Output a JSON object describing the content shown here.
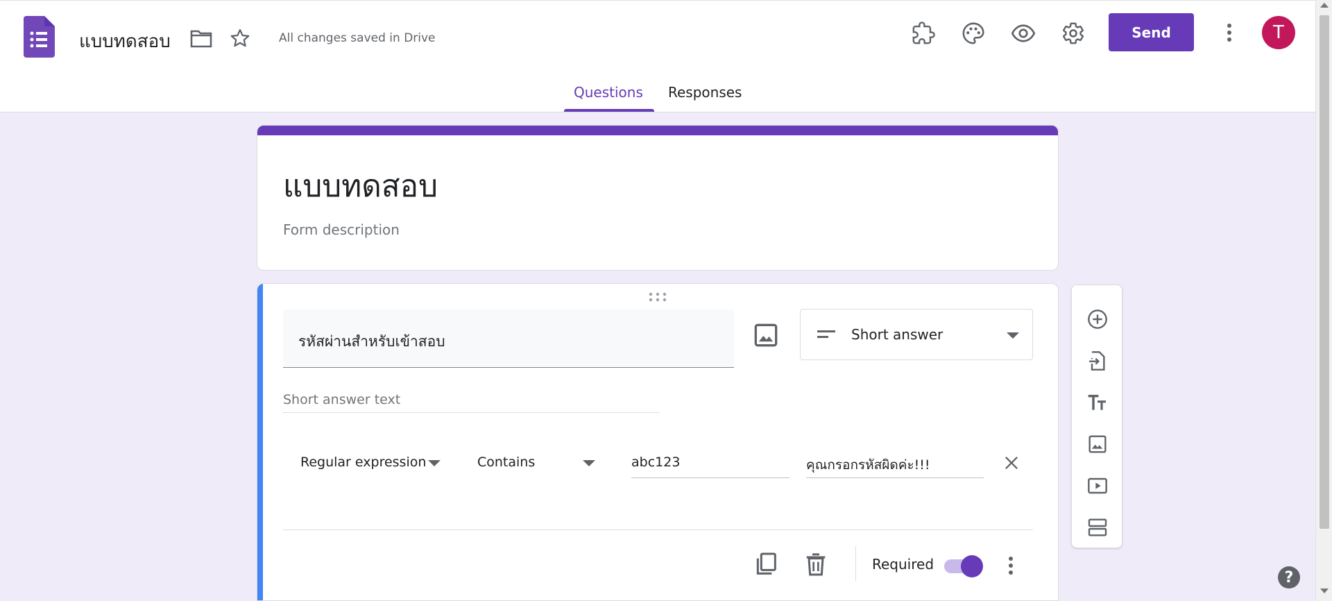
{
  "app": {
    "doc_title": "แบบทดสอบ",
    "save_status": "All changes saved in Drive",
    "send_label": "Send",
    "avatar_initial": "T"
  },
  "tabs": [
    {
      "label": "Questions",
      "active": true
    },
    {
      "label": "Responses",
      "active": false
    }
  ],
  "form": {
    "title": "แบบทดสอบ",
    "description_placeholder": "Form description"
  },
  "question": {
    "title": "รหัสผ่านสำหรับเข้าสอบ",
    "type_label": "Short answer",
    "answer_placeholder": "Short answer text",
    "validation": {
      "kind": "Regular expression",
      "condition": "Contains",
      "pattern": "abc123",
      "error_text": "คุณกรอกรหัสผิดค่ะ!!!"
    },
    "required_label": "Required",
    "required": true
  },
  "colors": {
    "accent": "#673ab7",
    "question_bar": "#4285f4",
    "avatar": "#c2185b",
    "background": "#f0ebf8"
  },
  "icons": {
    "header": [
      "forms-logo-icon",
      "folder-icon",
      "star-icon",
      "addon-puzzle-icon",
      "palette-icon",
      "preview-eye-icon",
      "settings-gear-icon",
      "more-vert-icon"
    ],
    "side_tools": [
      "add-question-icon",
      "import-questions-icon",
      "add-title-icon",
      "add-image-icon",
      "add-video-icon",
      "add-section-icon"
    ]
  }
}
